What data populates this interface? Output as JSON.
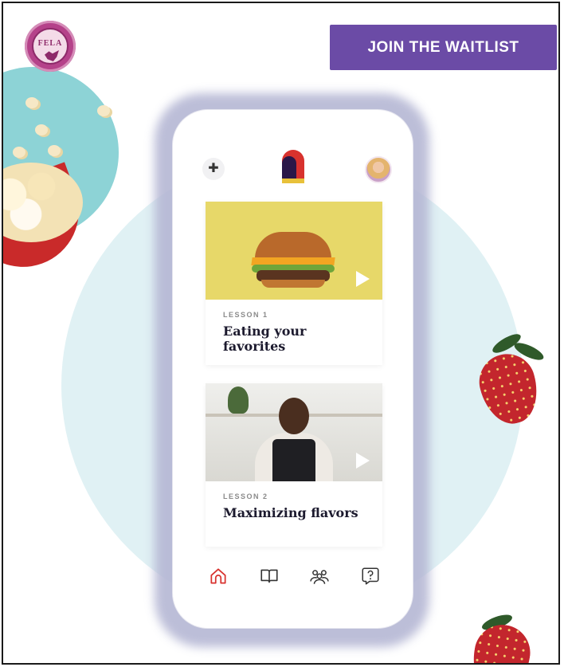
{
  "header": {
    "logo": {
      "text": "FELA",
      "icon": "state-seal-logo"
    },
    "cta_label": "JOIN THE WAITLIST"
  },
  "colors": {
    "cta_bg": "#6b4ba6",
    "accent_red": "#d8322e",
    "backdrop_circle": "#e0f1f4",
    "popcorn_circle": "#8dd3d6"
  },
  "app": {
    "top_bar": {
      "left_icon": "plus-icon",
      "center_icon": "app-logo",
      "right_icon": "avatar"
    },
    "lessons": [
      {
        "label": "LESSON 1",
        "title": "Eating your favorites",
        "thumbnail": "burger-image",
        "play_icon": "play-icon"
      },
      {
        "label": "LESSON 2",
        "title": "Maximizing flavors",
        "thumbnail": "chef-in-kitchen-image",
        "play_icon": "play-icon"
      }
    ],
    "tab_bar": [
      {
        "icon": "home-icon",
        "active": true
      },
      {
        "icon": "book-icon",
        "active": false
      },
      {
        "icon": "community-icon",
        "active": false
      },
      {
        "icon": "help-icon",
        "active": false
      }
    ]
  }
}
